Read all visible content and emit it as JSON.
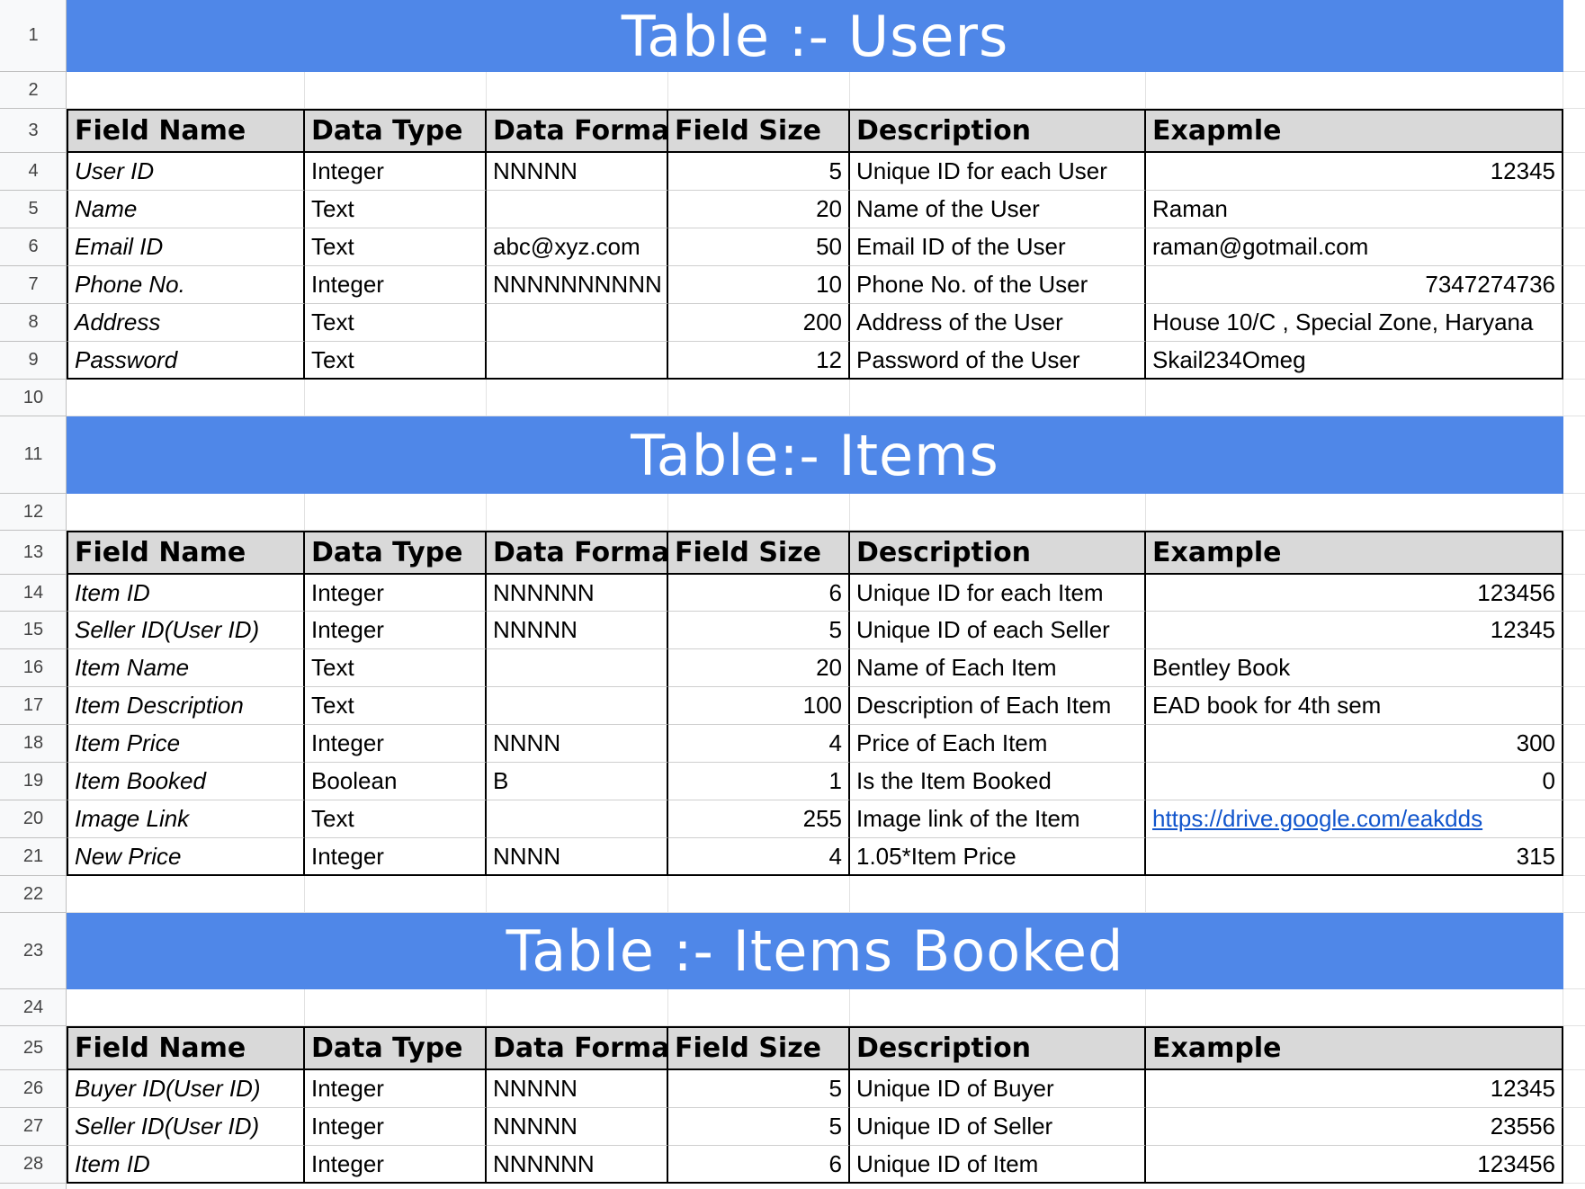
{
  "row_numbers": [
    "1",
    "2",
    "3",
    "4",
    "5",
    "6",
    "7",
    "8",
    "9",
    "10",
    "11",
    "12",
    "13",
    "14",
    "15",
    "16",
    "17",
    "18",
    "19",
    "20",
    "21",
    "22",
    "23",
    "24",
    "25",
    "26",
    "27",
    "28"
  ],
  "colors": {
    "banner": "#4f87e8",
    "header_bg": "#d9d9d9",
    "link": "#1155cc"
  },
  "tables": [
    {
      "title": "Table :- Users",
      "headers": [
        "Field Name",
        "Data Type",
        "Data Format",
        "Field Size",
        "Description",
        "Exapmle"
      ],
      "rows": [
        [
          "User ID",
          "Integer",
          "NNNNN",
          "5",
          "Unique ID for each User",
          "12345"
        ],
        [
          "Name",
          "Text",
          "",
          "20",
          "Name of the User",
          "Raman"
        ],
        [
          "Email ID",
          "Text",
          "abc@xyz.com",
          "50",
          "Email ID of the User",
          "raman@gotmail.com"
        ],
        [
          "Phone No.",
          "Integer",
          "NNNNNNNNNN",
          "10",
          "Phone No. of the User",
          "7347274736"
        ],
        [
          "Address",
          "Text",
          "",
          "200",
          "Address of the User",
          "House 10/C , Special Zone, Haryana"
        ],
        [
          "Password",
          "Text",
          "",
          "12",
          "Password of the User",
          "Skail234Omeg"
        ]
      ]
    },
    {
      "title": "Table:- Items",
      "headers": [
        "Field Name",
        "Data Type",
        "Data Format",
        "Field Size",
        "Description",
        "Example"
      ],
      "rows": [
        [
          "Item ID",
          "Integer",
          "NNNNNN",
          "6",
          "Unique ID for each Item",
          "123456"
        ],
        [
          "Seller ID(User ID)",
          "Integer",
          "NNNNN",
          "5",
          "Unique ID of each Seller",
          "12345"
        ],
        [
          "Item Name",
          "Text",
          "",
          "20",
          "Name of Each Item",
          "Bentley Book"
        ],
        [
          "Item Description",
          "Text",
          "",
          "100",
          "Description of Each Item",
          "EAD book for 4th sem"
        ],
        [
          "Item Price",
          "Integer",
          "NNNN",
          "4",
          "Price of Each Item",
          "300"
        ],
        [
          "Item Booked",
          "Boolean",
          "B",
          "1",
          "Is the Item Booked",
          "0"
        ],
        [
          "Image Link",
          "Text",
          "",
          "255",
          "Image link of the Item",
          "https://drive.google.com/eakdds"
        ],
        [
          "New Price",
          "Integer",
          "NNNN",
          "4",
          "1.05*Item Price",
          "315"
        ]
      ]
    },
    {
      "title": "Table :- Items Booked",
      "headers": [
        "Field Name",
        "Data Type",
        "Data Format",
        "Field Size",
        "Description",
        "Example"
      ],
      "rows": [
        [
          "Buyer ID(User ID)",
          "Integer",
          "NNNNN",
          "5",
          "Unique ID of Buyer",
          "12345"
        ],
        [
          "Seller ID(User ID)",
          "Integer",
          "NNNNN",
          "5",
          "Unique ID of Seller",
          "23556"
        ],
        [
          "Item ID",
          "Integer",
          "NNNNNN",
          "6",
          "Unique ID of Item",
          "123456"
        ]
      ]
    }
  ]
}
